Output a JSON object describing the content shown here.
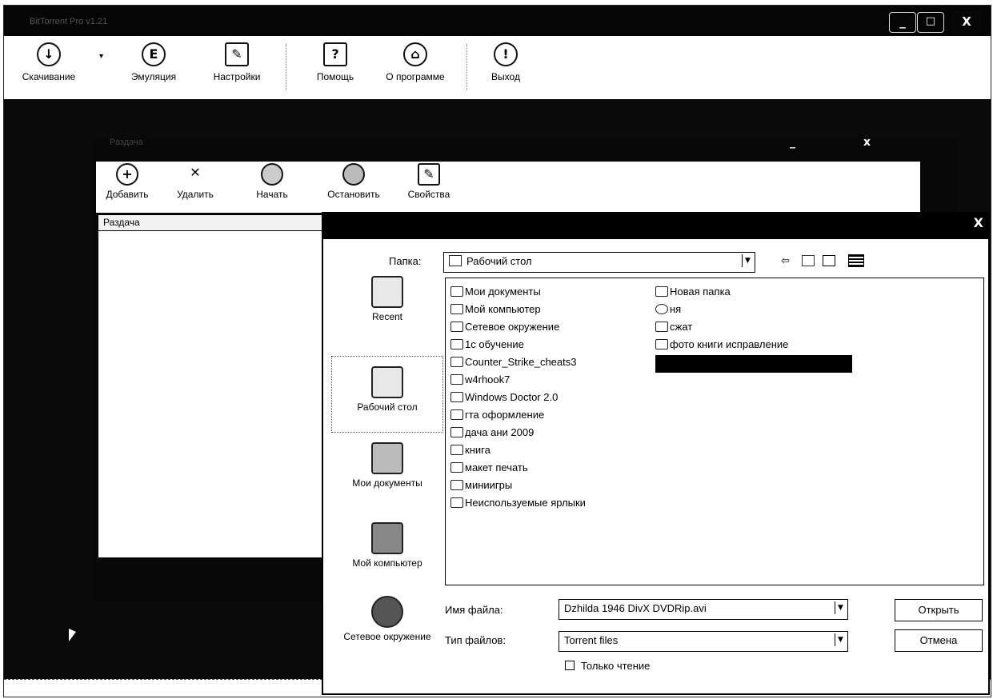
{
  "app": {
    "title": "BitTorrent Pro v1.21",
    "controls": [
      "_",
      "□",
      "X"
    ]
  },
  "main_toolbar": {
    "items": [
      {
        "label": "Скачивание",
        "icon": "download-icon",
        "glyph": "↓"
      },
      {
        "label": "Эмуляция",
        "icon": "emulation-icon",
        "glyph": "E"
      },
      {
        "label": "Настройки",
        "icon": "settings-icon",
        "glyph": "✎"
      },
      {
        "label": "Помощь",
        "icon": "help-icon",
        "glyph": "?"
      },
      {
        "label": "О программе",
        "icon": "about-icon",
        "glyph": "⌂"
      },
      {
        "label": "Выход",
        "icon": "exit-icon",
        "glyph": "!"
      }
    ]
  },
  "distribution_window": {
    "title": "Раздача",
    "toolbar": [
      {
        "label": "Добавить",
        "icon": "add-icon",
        "glyph": "+"
      },
      {
        "label": "Удалить",
        "icon": "delete-icon",
        "glyph": "✕"
      },
      {
        "label": "Начать",
        "icon": "start-icon",
        "glyph": ""
      },
      {
        "label": "Остановить",
        "icon": "stop-icon",
        "glyph": ""
      },
      {
        "label": "Свойства",
        "icon": "properties-icon",
        "glyph": "✎"
      }
    ],
    "list_header": "Раздача"
  },
  "open_dialog": {
    "close": "X",
    "folder_label": "Папка:",
    "folder_value": "Рабочий стол",
    "places": [
      {
        "label": "Recent",
        "icon": "recent-folder-icon"
      },
      {
        "label": "Рабочий стол",
        "icon": "desktop-icon"
      },
      {
        "label": "Мои документы",
        "icon": "my-documents-icon"
      },
      {
        "label": "Мой компьютер",
        "icon": "my-computer-icon"
      },
      {
        "label": "Сетевое окружение",
        "icon": "network-icon"
      }
    ],
    "files_col1": [
      "Мои документы",
      "Мой компьютер",
      "Сетевое окружение",
      "1с обучение",
      "Counter_Strike_cheats3",
      "w4rhook7",
      "Windows Doctor 2.0",
      "гта оформление",
      "дача ани 2009",
      "книга",
      "макет печать",
      "миниигры",
      "Неиспользуемые ярлыки"
    ],
    "files_col2": [
      "Новая папка",
      "ня",
      "сжат",
      "фото книги исправление"
    ],
    "filename_label": "Имя файла:",
    "filename_value": "Dzhilda 1946 DivX DVDRip.avi",
    "filetype_label": "Тип файлов:",
    "filetype_value": "Torrent files",
    "readonly_label": "Только чтение",
    "open_button": "Открыть",
    "cancel_button": "Отмена"
  }
}
